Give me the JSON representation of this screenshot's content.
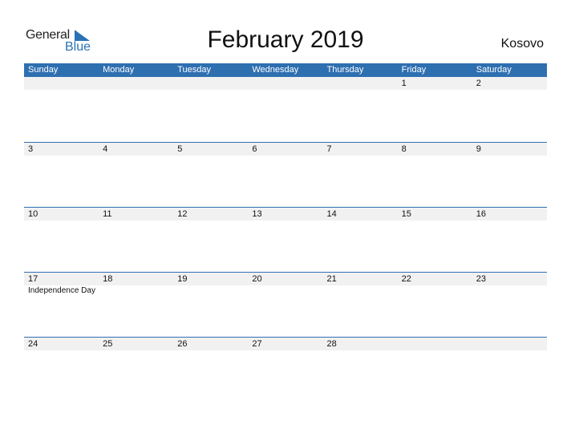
{
  "logo": {
    "general": "General",
    "blue": "Blue"
  },
  "header": {
    "title": "February 2019",
    "country": "Kosovo"
  },
  "colors": {
    "accent": "#2e6fb0",
    "strip": "#f1f1f1"
  },
  "days": [
    "Sunday",
    "Monday",
    "Tuesday",
    "Wednesday",
    "Thursday",
    "Friday",
    "Saturday"
  ],
  "weeks": [
    {
      "dates": [
        "",
        "",
        "",
        "",
        "",
        "1",
        "2"
      ],
      "events": [
        "",
        "",
        "",
        "",
        "",
        "",
        ""
      ]
    },
    {
      "dates": [
        "3",
        "4",
        "5",
        "6",
        "7",
        "8",
        "9"
      ],
      "events": [
        "",
        "",
        "",
        "",
        "",
        "",
        ""
      ]
    },
    {
      "dates": [
        "10",
        "11",
        "12",
        "13",
        "14",
        "15",
        "16"
      ],
      "events": [
        "",
        "",
        "",
        "",
        "",
        "",
        ""
      ]
    },
    {
      "dates": [
        "17",
        "18",
        "19",
        "20",
        "21",
        "22",
        "23"
      ],
      "events": [
        "Independence Day",
        "",
        "",
        "",
        "",
        "",
        ""
      ]
    },
    {
      "dates": [
        "24",
        "25",
        "26",
        "27",
        "28",
        "",
        ""
      ],
      "events": [
        "",
        "",
        "",
        "",
        "",
        "",
        ""
      ]
    }
  ]
}
